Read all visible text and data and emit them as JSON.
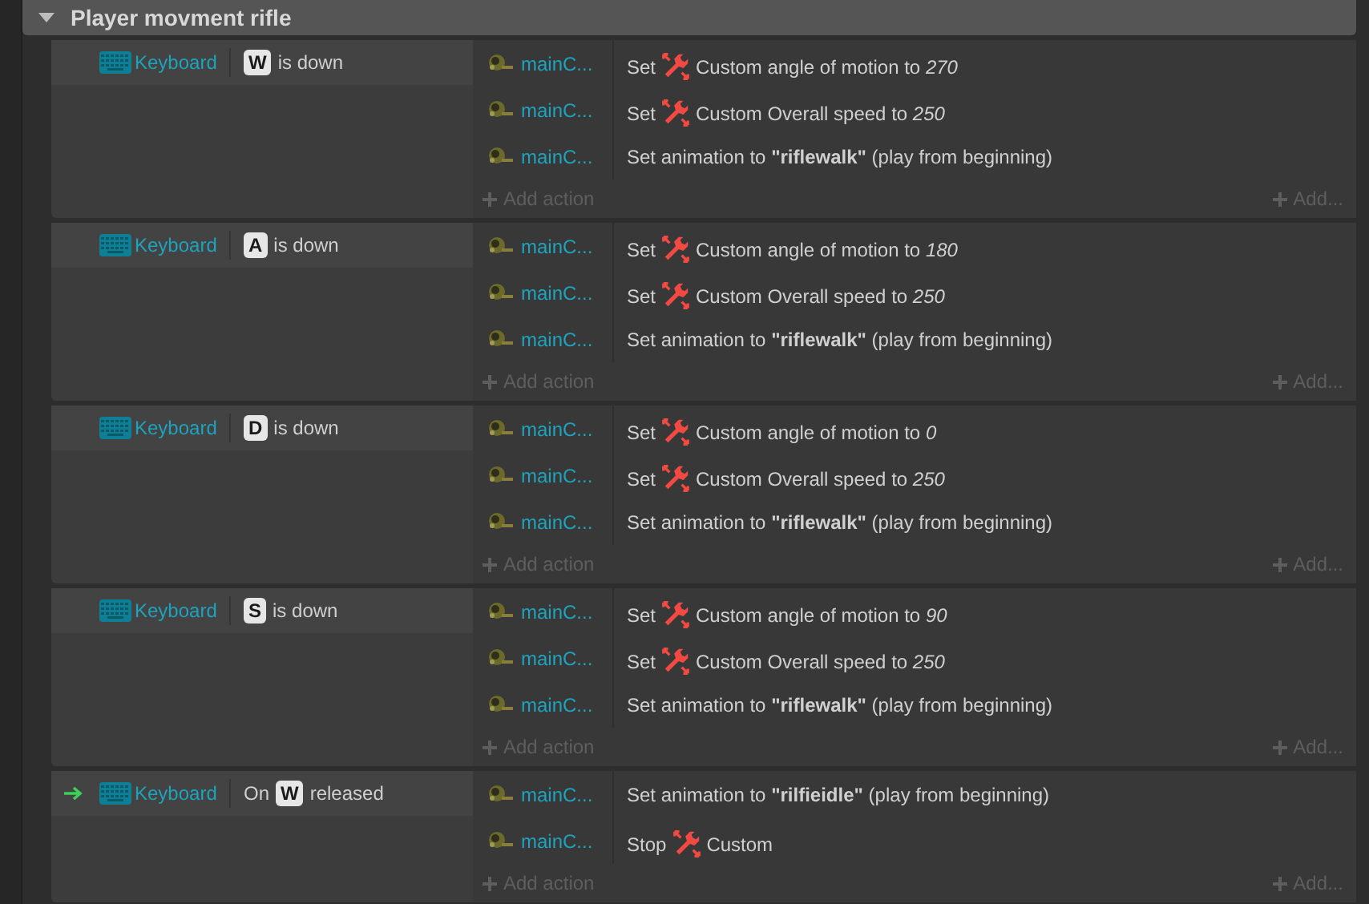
{
  "group": {
    "title": "Player movment rifle",
    "expanded": true
  },
  "events": [
    {
      "trigger": false,
      "condition": {
        "object": "Keyboard",
        "key": "W",
        "suffix": "is down"
      },
      "actions": [
        {
          "kind": "behavior",
          "object": "mainC...",
          "prefix": "Set",
          "text": "Custom angle of motion to *270*"
        },
        {
          "kind": "behavior",
          "object": "mainC...",
          "prefix": "Set",
          "text": "Custom Overall speed to *250*"
        },
        {
          "kind": "plain",
          "object": "mainC...",
          "text": "Set animation to **\"riflewalk\"** (play from beginning)"
        }
      ],
      "add_action": "Add action",
      "add_more": "Add..."
    },
    {
      "trigger": false,
      "condition": {
        "object": "Keyboard",
        "key": "A",
        "suffix": "is down"
      },
      "actions": [
        {
          "kind": "behavior",
          "object": "mainC...",
          "prefix": "Set",
          "text": "Custom angle of motion to *180*"
        },
        {
          "kind": "behavior",
          "object": "mainC...",
          "prefix": "Set",
          "text": "Custom Overall speed to *250*"
        },
        {
          "kind": "plain",
          "object": "mainC...",
          "text": "Set animation to **\"riflewalk\"** (play from beginning)"
        }
      ],
      "add_action": "Add action",
      "add_more": "Add..."
    },
    {
      "trigger": false,
      "condition": {
        "object": "Keyboard",
        "key": "D",
        "suffix": "is down"
      },
      "actions": [
        {
          "kind": "behavior",
          "object": "mainC...",
          "prefix": "Set",
          "text": "Custom angle of motion to *0*"
        },
        {
          "kind": "behavior",
          "object": "mainC...",
          "prefix": "Set",
          "text": "Custom Overall speed to *250*"
        },
        {
          "kind": "plain",
          "object": "mainC...",
          "text": "Set animation to **\"riflewalk\"** (play from beginning)"
        }
      ],
      "add_action": "Add action",
      "add_more": "Add..."
    },
    {
      "trigger": false,
      "condition": {
        "object": "Keyboard",
        "key": "S",
        "suffix": "is down"
      },
      "actions": [
        {
          "kind": "behavior",
          "object": "mainC...",
          "prefix": "Set",
          "text": "Custom angle of motion to *90*"
        },
        {
          "kind": "behavior",
          "object": "mainC...",
          "prefix": "Set",
          "text": "Custom Overall speed to *250*"
        },
        {
          "kind": "plain",
          "object": "mainC...",
          "text": "Set animation to **\"riflewalk\"** (play from beginning)"
        }
      ],
      "add_action": "Add action",
      "add_more": "Add..."
    },
    {
      "trigger": true,
      "condition": {
        "object": "Keyboard",
        "prefix": "On",
        "key": "W",
        "suffix": "released"
      },
      "actions": [
        {
          "kind": "plain",
          "object": "mainC...",
          "text": "Set animation to **\"rilfieidle\"** (play from beginning)"
        },
        {
          "kind": "behavior",
          "object": "mainC...",
          "prefix": "Stop",
          "text": "Custom"
        }
      ],
      "add_action": "Add action",
      "add_more": "Add..."
    }
  ]
}
